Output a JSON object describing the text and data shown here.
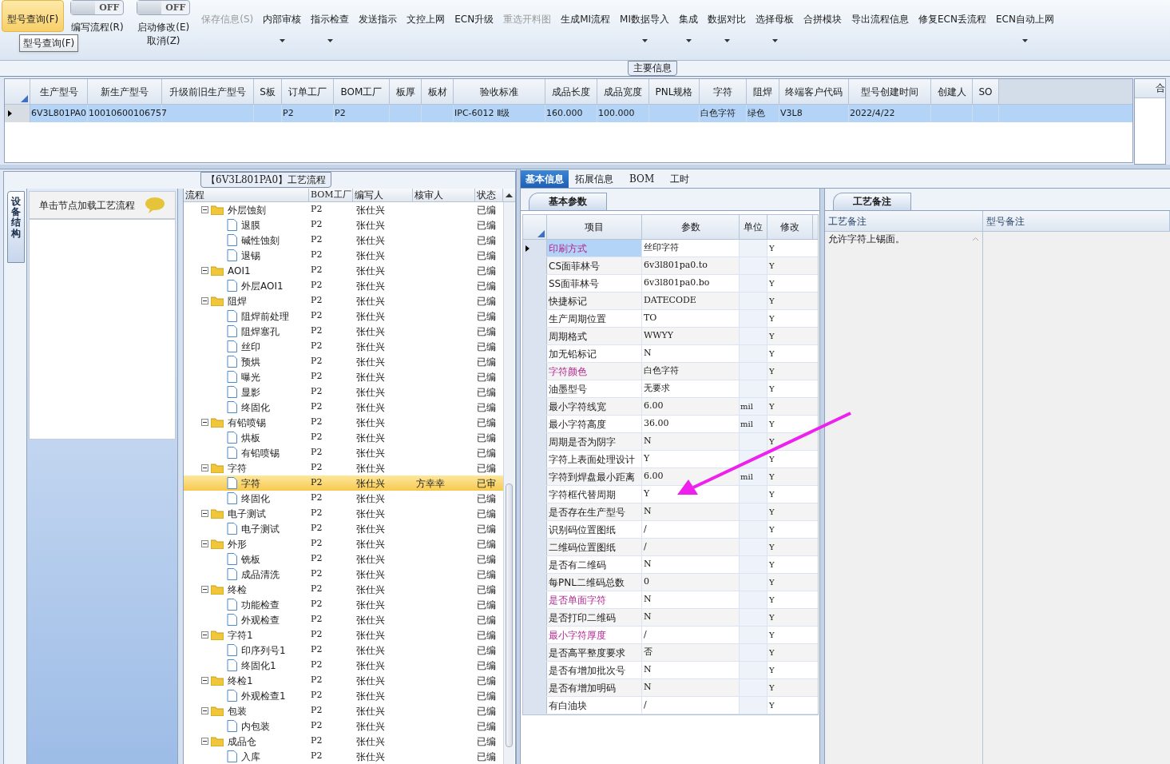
{
  "toolbar": [
    {
      "kind": "button",
      "label": "型号查询(F)",
      "highlighted": true,
      "disabled": false,
      "dropdown": false
    },
    {
      "kind": "toggle",
      "label": "编写流程(R)",
      "state_text": "OFF",
      "on": false
    },
    {
      "kind": "toggle",
      "label": "启动修改(E)",
      "sublabel": "取消(Z)",
      "state_text": "OFF",
      "on": false
    },
    {
      "kind": "button",
      "label": "保存信息(S)",
      "highlighted": false,
      "disabled": true,
      "dropdown": false
    },
    {
      "kind": "button",
      "label": "内部审核",
      "highlighted": false,
      "disabled": false,
      "dropdown": true
    },
    {
      "kind": "button",
      "label": "指示检查",
      "highlighted": false,
      "disabled": false,
      "dropdown": true
    },
    {
      "kind": "button",
      "label": "发送指示",
      "highlighted": false,
      "disabled": false,
      "dropdown": false
    },
    {
      "kind": "button",
      "label": "文控上网",
      "highlighted": false,
      "disabled": false,
      "dropdown": false
    },
    {
      "kind": "button",
      "label": "ECN升级",
      "highlighted": false,
      "disabled": false,
      "dropdown": false
    },
    {
      "kind": "button",
      "label": "重选开料图",
      "highlighted": false,
      "disabled": true,
      "dropdown": false
    },
    {
      "kind": "button",
      "label": "生成MI流程",
      "highlighted": false,
      "disabled": false,
      "dropdown": false
    },
    {
      "kind": "button",
      "label": "MI数据导入",
      "highlighted": false,
      "disabled": false,
      "dropdown": true
    },
    {
      "kind": "button",
      "label": "集成",
      "highlighted": false,
      "disabled": false,
      "dropdown": true
    },
    {
      "kind": "button",
      "label": "数据对比",
      "highlighted": false,
      "disabled": false,
      "dropdown": true
    },
    {
      "kind": "button",
      "label": "选择母板",
      "highlighted": false,
      "disabled": false,
      "dropdown": true
    },
    {
      "kind": "button",
      "label": "合拼模块",
      "highlighted": false,
      "disabled": false,
      "dropdown": false
    },
    {
      "kind": "button",
      "label": "导出流程信息",
      "highlighted": false,
      "disabled": false,
      "dropdown": false
    },
    {
      "kind": "button",
      "label": "修复ECN丢流程",
      "highlighted": false,
      "disabled": false,
      "dropdown": false
    },
    {
      "kind": "button",
      "label": "ECN自动上网",
      "highlighted": false,
      "disabled": false,
      "dropdown": true
    }
  ],
  "tooltip": "型号查询(F)",
  "main_info": {
    "title": "主要信息",
    "columns": [
      "生产型号",
      "新生产型号",
      "升级前旧生产型号",
      "S板",
      "订单工厂",
      "BOM工厂",
      "板厚",
      "板材",
      "验收标准",
      "成品长度",
      "成品宽度",
      "PNL规格",
      "字符",
      "阻焊",
      "终端客户代码",
      "型号创建时间",
      "创建人",
      "SO"
    ],
    "rows": [
      {
        "selected": true,
        "cells": [
          "6V3L801PA0",
          "10010600106757",
          null,
          null,
          "P2",
          "P2",
          null,
          null,
          "IPC-6012 Ⅱ级",
          "160.000",
          "100.000",
          null,
          "白色字符",
          "绿色",
          "V3L8",
          "2022/4/22",
          null,
          null
        ]
      }
    ],
    "side_column": "合"
  },
  "process": {
    "title": "【6V3L801PA0】工艺流程",
    "side_tab": "设备结构",
    "hint": "单击节点加载工艺流程",
    "columns": [
      "流程",
      "BOM工厂",
      "编写人",
      "核审人",
      "状态"
    ],
    "tree": [
      {
        "name": "外层蚀刻",
        "bom": "P2",
        "writer": "张仕兴",
        "status": "已编",
        "selected": false,
        "children": [
          {
            "name": "退膜",
            "bom": "P2",
            "writer": "张仕兴",
            "status": "已编",
            "selected": false
          },
          {
            "name": "碱性蚀刻",
            "bom": "P2",
            "writer": "张仕兴",
            "status": "已编",
            "selected": false
          },
          {
            "name": "退锡",
            "bom": "P2",
            "writer": "张仕兴",
            "status": "已编",
            "selected": false
          }
        ]
      },
      {
        "name": "AOI1",
        "bom": "P2",
        "writer": "张仕兴",
        "status": "已编",
        "selected": false,
        "children": [
          {
            "name": "外层AOI1",
            "bom": "P2",
            "writer": "张仕兴",
            "status": "已编",
            "selected": false
          }
        ]
      },
      {
        "name": "阻焊",
        "bom": "P2",
        "writer": "张仕兴",
        "status": "已编",
        "selected": false,
        "children": [
          {
            "name": "阻焊前处理",
            "bom": "P2",
            "writer": "张仕兴",
            "status": "已编",
            "selected": false
          },
          {
            "name": "阻焊塞孔",
            "bom": "P2",
            "writer": "张仕兴",
            "status": "已编",
            "selected": false
          },
          {
            "name": "丝印",
            "bom": "P2",
            "writer": "张仕兴",
            "status": "已编",
            "selected": false
          },
          {
            "name": "预烘",
            "bom": "P2",
            "writer": "张仕兴",
            "status": "已编",
            "selected": false
          },
          {
            "name": "曝光",
            "bom": "P2",
            "writer": "张仕兴",
            "status": "已编",
            "selected": false
          },
          {
            "name": "显影",
            "bom": "P2",
            "writer": "张仕兴",
            "status": "已编",
            "selected": false
          },
          {
            "name": "终固化",
            "bom": "P2",
            "writer": "张仕兴",
            "status": "已编",
            "selected": false
          }
        ]
      },
      {
        "name": "有铅喷锡",
        "bom": "P2",
        "writer": "张仕兴",
        "status": "已编",
        "selected": false,
        "children": [
          {
            "name": "烘板",
            "bom": "P2",
            "writer": "张仕兴",
            "status": "已编",
            "selected": false
          },
          {
            "name": "有铅喷锡",
            "bom": "P2",
            "writer": "张仕兴",
            "status": "已编",
            "selected": false
          }
        ]
      },
      {
        "name": "字符",
        "bom": "P2",
        "writer": "张仕兴",
        "status": "已编",
        "selected": false,
        "children": [
          {
            "name": "字符",
            "bom": "P2",
            "writer": "张仕兴",
            "reviewer": "方幸幸",
            "status": "已审",
            "selected": true
          },
          {
            "name": "终固化",
            "bom": "P2",
            "writer": "张仕兴",
            "status": "已编",
            "selected": false
          }
        ]
      },
      {
        "name": "电子测试",
        "bom": "P2",
        "writer": "张仕兴",
        "status": "已编",
        "selected": false,
        "children": [
          {
            "name": "电子测试",
            "bom": "P2",
            "writer": "张仕兴",
            "status": "已编",
            "selected": false
          }
        ]
      },
      {
        "name": "外形",
        "bom": "P2",
        "writer": "张仕兴",
        "status": "已编",
        "selected": false,
        "children": [
          {
            "name": "铣板",
            "bom": "P2",
            "writer": "张仕兴",
            "status": "已编",
            "selected": false
          },
          {
            "name": "成品清洗",
            "bom": "P2",
            "writer": "张仕兴",
            "status": "已编",
            "selected": false
          }
        ]
      },
      {
        "name": "终检",
        "bom": "P2",
        "writer": "张仕兴",
        "status": "已编",
        "selected": false,
        "children": [
          {
            "name": "功能检查",
            "bom": "P2",
            "writer": "张仕兴",
            "status": "已编",
            "selected": false
          },
          {
            "name": "外观检查",
            "bom": "P2",
            "writer": "张仕兴",
            "status": "已编",
            "selected": false
          }
        ]
      },
      {
        "name": "字符1",
        "bom": "P2",
        "writer": "张仕兴",
        "status": "已编",
        "selected": false,
        "children": [
          {
            "name": "印序列号1",
            "bom": "P2",
            "writer": "张仕兴",
            "status": "已编",
            "selected": false
          },
          {
            "name": "终固化1",
            "bom": "P2",
            "writer": "张仕兴",
            "status": "已编",
            "selected": false
          }
        ]
      },
      {
        "name": "终检1",
        "bom": "P2",
        "writer": "张仕兴",
        "status": "已编",
        "selected": false,
        "children": [
          {
            "name": "外观检查1",
            "bom": "P2",
            "writer": "张仕兴",
            "status": "已编",
            "selected": false
          }
        ]
      },
      {
        "name": "包装",
        "bom": "P2",
        "writer": "张仕兴",
        "status": "已编",
        "selected": false,
        "children": [
          {
            "name": "内包装",
            "bom": "P2",
            "writer": "张仕兴",
            "status": "已编",
            "selected": false
          }
        ]
      },
      {
        "name": "成品仓",
        "bom": "P2",
        "writer": "张仕兴",
        "status": "已编",
        "selected": false,
        "children": [
          {
            "name": "入库",
            "bom": "P2",
            "writer": "张仕兴",
            "status": "已编",
            "selected": false
          }
        ]
      }
    ]
  },
  "detail_tabs": [
    {
      "label": "基本信息",
      "selected": true
    },
    {
      "label": "拓展信息",
      "selected": false
    },
    {
      "label": "BOM",
      "selected": false
    },
    {
      "label": "工时",
      "selected": false
    }
  ],
  "basic_params": {
    "title": "基本参数",
    "columns": [
      "项目",
      "参数",
      "单位",
      "修改"
    ],
    "rows": [
      {
        "item": "印刷方式",
        "value": "丝印字符",
        "modify": "Y",
        "highlighted": true,
        "selected": true
      },
      {
        "item": "CS面菲林号",
        "value": "6v3l801pa0.to",
        "modify": "Y",
        "highlighted": false,
        "selected": false
      },
      {
        "item": "SS面菲林号",
        "value": "6v3l801pa0.bo",
        "modify": "Y",
        "highlighted": false,
        "selected": false
      },
      {
        "item": "快捷标记",
        "value": "DATECODE",
        "modify": "Y",
        "highlighted": false,
        "selected": false
      },
      {
        "item": "生产周期位置",
        "value": "TO",
        "modify": "Y",
        "highlighted": false,
        "selected": false
      },
      {
        "item": "周期格式",
        "value": "WWYY",
        "modify": "Y",
        "highlighted": false,
        "selected": false
      },
      {
        "item": "加无铅标记",
        "value": "N",
        "modify": "Y",
        "highlighted": false,
        "selected": false
      },
      {
        "item": "字符颜色",
        "value": "白色字符",
        "modify": "Y",
        "highlighted": true,
        "selected": false
      },
      {
        "item": "油墨型号",
        "value": "无要求",
        "modify": "Y",
        "highlighted": false,
        "selected": false
      },
      {
        "item": "最小字符线宽",
        "value": "6.00",
        "unit": "mil",
        "modify": "Y",
        "highlighted": false,
        "selected": false
      },
      {
        "item": "最小字符高度",
        "value": "36.00",
        "unit": "mil",
        "modify": "Y",
        "highlighted": false,
        "selected": false
      },
      {
        "item": "周期是否为阴字",
        "value": "N",
        "modify": "Y",
        "highlighted": false,
        "selected": false
      },
      {
        "item": "字符上表面处理设计",
        "value": "Y",
        "modify": "Y",
        "highlighted": false,
        "selected": false
      },
      {
        "item": "字符到焊盘最小距离",
        "value": "6.00",
        "unit": "mil",
        "modify": "Y",
        "highlighted": false,
        "selected": false
      },
      {
        "item": "字符框代替周期",
        "value": "Y",
        "modify": "Y",
        "highlighted": false,
        "selected": false
      },
      {
        "item": "是否存在生产型号",
        "value": "N",
        "modify": "Y",
        "highlighted": false,
        "selected": false
      },
      {
        "item": "识别码位置图纸",
        "value": "/",
        "modify": "Y",
        "highlighted": false,
        "selected": false
      },
      {
        "item": "二维码位置图纸",
        "value": "/",
        "modify": "Y",
        "highlighted": false,
        "selected": false
      },
      {
        "item": "是否有二维码",
        "value": "N",
        "modify": "Y",
        "highlighted": false,
        "selected": false
      },
      {
        "item": "每PNL二维码总数",
        "value": "0",
        "modify": "Y",
        "highlighted": false,
        "selected": false
      },
      {
        "item": "是否单面字符",
        "value": "N",
        "modify": "Y",
        "highlighted": true,
        "selected": false
      },
      {
        "item": "是否打印二维码",
        "value": "N",
        "modify": "Y",
        "highlighted": false,
        "selected": false
      },
      {
        "item": "最小字符厚度",
        "value": "/",
        "modify": "Y",
        "highlighted": true,
        "selected": false
      },
      {
        "item": "是否高平整度要求",
        "value": "否",
        "modify": "Y",
        "highlighted": false,
        "selected": false
      },
      {
        "item": "是否有增加批次号",
        "value": "N",
        "modify": "Y",
        "highlighted": false,
        "selected": false
      },
      {
        "item": "是否有增加明码",
        "value": "N",
        "modify": "Y",
        "highlighted": false,
        "selected": false
      },
      {
        "item": "有白油块",
        "value": "/",
        "modify": "Y",
        "highlighted": false,
        "selected": false
      }
    ]
  },
  "remarks": {
    "title": "工艺备注",
    "columns": [
      "工艺备注",
      "型号备注"
    ],
    "process_remark": "允许字符上锡面。"
  },
  "annotation": {
    "kind": "arrow"
  }
}
